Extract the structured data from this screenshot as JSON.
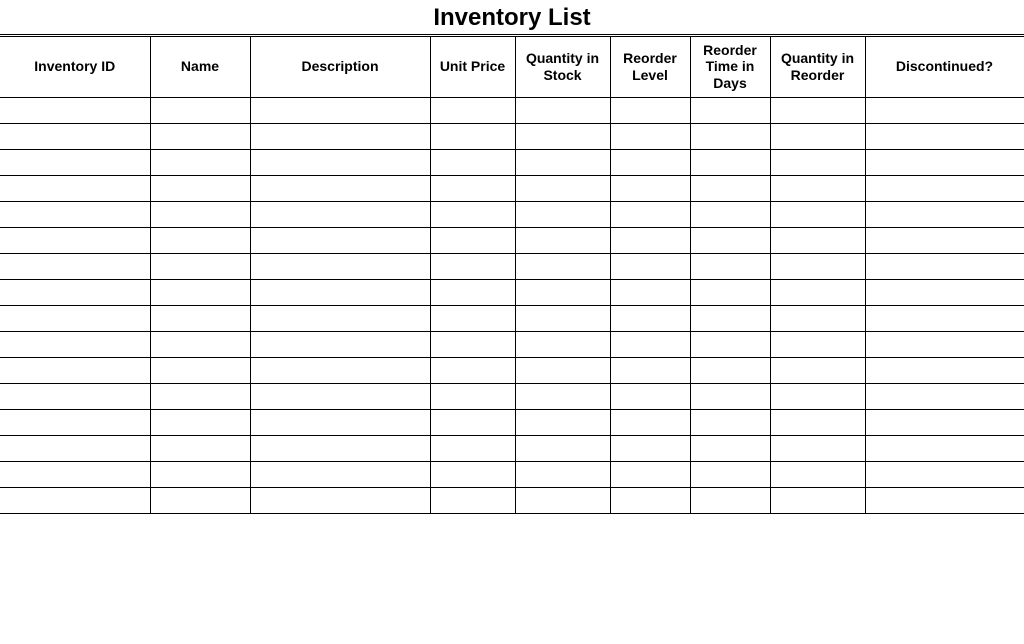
{
  "title": "Inventory List",
  "columns": [
    "Inventory ID",
    "Name",
    "Description",
    "Unit Price",
    "Quantity in Stock",
    "Reorder Level",
    "Reorder Time in Days",
    "Quantity in Reorder",
    "Discontinued?"
  ],
  "rows": [
    [
      "",
      "",
      "",
      "",
      "",
      "",
      "",
      "",
      ""
    ],
    [
      "",
      "",
      "",
      "",
      "",
      "",
      "",
      "",
      ""
    ],
    [
      "",
      "",
      "",
      "",
      "",
      "",
      "",
      "",
      ""
    ],
    [
      "",
      "",
      "",
      "",
      "",
      "",
      "",
      "",
      ""
    ],
    [
      "",
      "",
      "",
      "",
      "",
      "",
      "",
      "",
      ""
    ],
    [
      "",
      "",
      "",
      "",
      "",
      "",
      "",
      "",
      ""
    ],
    [
      "",
      "",
      "",
      "",
      "",
      "",
      "",
      "",
      ""
    ],
    [
      "",
      "",
      "",
      "",
      "",
      "",
      "",
      "",
      ""
    ],
    [
      "",
      "",
      "",
      "",
      "",
      "",
      "",
      "",
      ""
    ],
    [
      "",
      "",
      "",
      "",
      "",
      "",
      "",
      "",
      ""
    ],
    [
      "",
      "",
      "",
      "",
      "",
      "",
      "",
      "",
      ""
    ],
    [
      "",
      "",
      "",
      "",
      "",
      "",
      "",
      "",
      ""
    ],
    [
      "",
      "",
      "",
      "",
      "",
      "",
      "",
      "",
      ""
    ],
    [
      "",
      "",
      "",
      "",
      "",
      "",
      "",
      "",
      ""
    ],
    [
      "",
      "",
      "",
      "",
      "",
      "",
      "",
      "",
      ""
    ],
    [
      "",
      "",
      "",
      "",
      "",
      "",
      "",
      "",
      ""
    ]
  ],
  "plain_row_count": 5
}
